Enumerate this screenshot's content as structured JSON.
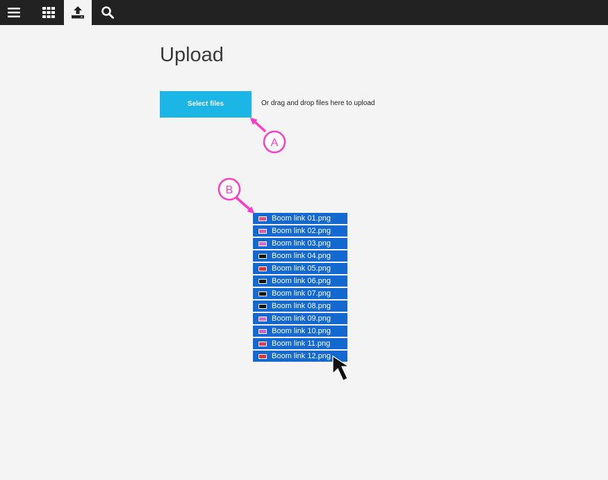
{
  "nav": {
    "items": [
      {
        "name": "menu-button",
        "icon": "hamburger-icon",
        "active": false
      },
      {
        "name": "grid-button",
        "icon": "grid-icon",
        "active": false
      },
      {
        "name": "upload-nav-button",
        "icon": "upload-icon",
        "active": true
      },
      {
        "name": "search-button",
        "icon": "search-icon",
        "active": false
      }
    ]
  },
  "main": {
    "title": "Upload",
    "select_files_label": "Select files",
    "drop_hint": "Or drag and drop files here to upload"
  },
  "drag_files": [
    {
      "name": "Boom link 01.png",
      "icon_color": "#e84a8a"
    },
    {
      "name": "Boom link 02.png",
      "icon_color": "#d85fb8"
    },
    {
      "name": "Boom link 03.png",
      "icon_color": "#d96ad1"
    },
    {
      "name": "Boom link 04.png",
      "icon_color": "#111111"
    },
    {
      "name": "Boom link 05.png",
      "icon_color": "#e03030"
    },
    {
      "name": "Boom link 06.png",
      "icon_color": "#111111"
    },
    {
      "name": "Boom link 07.png",
      "icon_color": "#111111"
    },
    {
      "name": "Boom link 08.png",
      "icon_color": "#111111"
    },
    {
      "name": "Boom link 09.png",
      "icon_color": "#d96ad1"
    },
    {
      "name": "Boom link 10.png",
      "icon_color": "#c860d0"
    },
    {
      "name": "Boom link 11.png",
      "icon_color": "#e03d5e"
    },
    {
      "name": "Boom link 12.png",
      "icon_color": "#e03030"
    }
  ],
  "annotations": [
    {
      "label": "A",
      "color": "#ff3cc8"
    },
    {
      "label": "B",
      "color": "#ff3cc8"
    }
  ],
  "colors": {
    "topbar": "#222222",
    "select_button": "#1bb6e6",
    "file_row": "#1469d1",
    "background": "#f4f4f4"
  }
}
